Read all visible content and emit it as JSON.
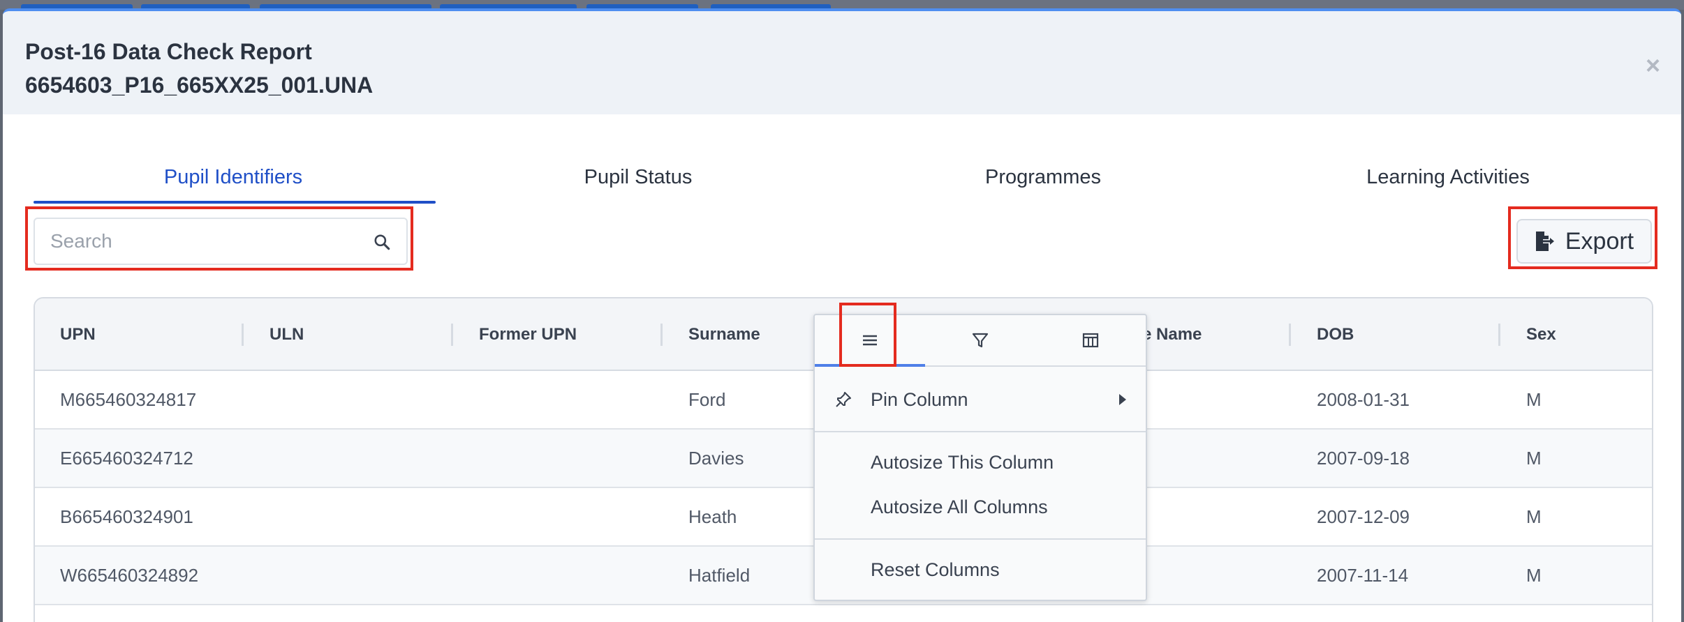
{
  "modal": {
    "title": "Post-16 Data Check Report",
    "filename": "6654603_P16_665XX25_001.UNA",
    "close_icon": "×"
  },
  "tabs": [
    {
      "label": "Pupil Identifiers",
      "active": true
    },
    {
      "label": "Pupil Status",
      "active": false
    },
    {
      "label": "Programmes",
      "active": false
    },
    {
      "label": "Learning Activities",
      "active": false
    }
  ],
  "search": {
    "placeholder": "Search",
    "value": "",
    "icon": "search-icon"
  },
  "export": {
    "label": "Export",
    "icon": "file-export-icon"
  },
  "grid": {
    "columns": [
      "UPN",
      "ULN",
      "Former UPN",
      "Surname",
      "",
      "e Name",
      "DOB",
      "Sex"
    ],
    "rows": [
      {
        "upn": "M665460324817",
        "uln": "",
        "former_upn": "",
        "surname": "Ford",
        "dob": "2008-01-31",
        "sex": "M"
      },
      {
        "upn": "E665460324712",
        "uln": "",
        "former_upn": "",
        "surname": "Davies",
        "dob": "2007-09-18",
        "sex": "M"
      },
      {
        "upn": "B665460324901",
        "uln": "",
        "former_upn": "",
        "surname": "Heath",
        "dob": "2007-12-09",
        "sex": "M"
      },
      {
        "upn": "W665460324892",
        "uln": "",
        "former_upn": "",
        "surname": "Hatfield",
        "dob": "2007-11-14",
        "sex": "M"
      }
    ]
  },
  "column_menu": {
    "tabs": [
      "menu-lines-icon",
      "filter-icon",
      "columns-icon"
    ],
    "items": {
      "pin_column": "Pin Column",
      "autosize_this": "Autosize This Column",
      "autosize_all": "Autosize All Columns",
      "reset_columns": "Reset Columns"
    }
  },
  "colors": {
    "accent": "#1f4fc7",
    "highlight": "#e42b1f",
    "header_bg": "#eef2f7"
  }
}
